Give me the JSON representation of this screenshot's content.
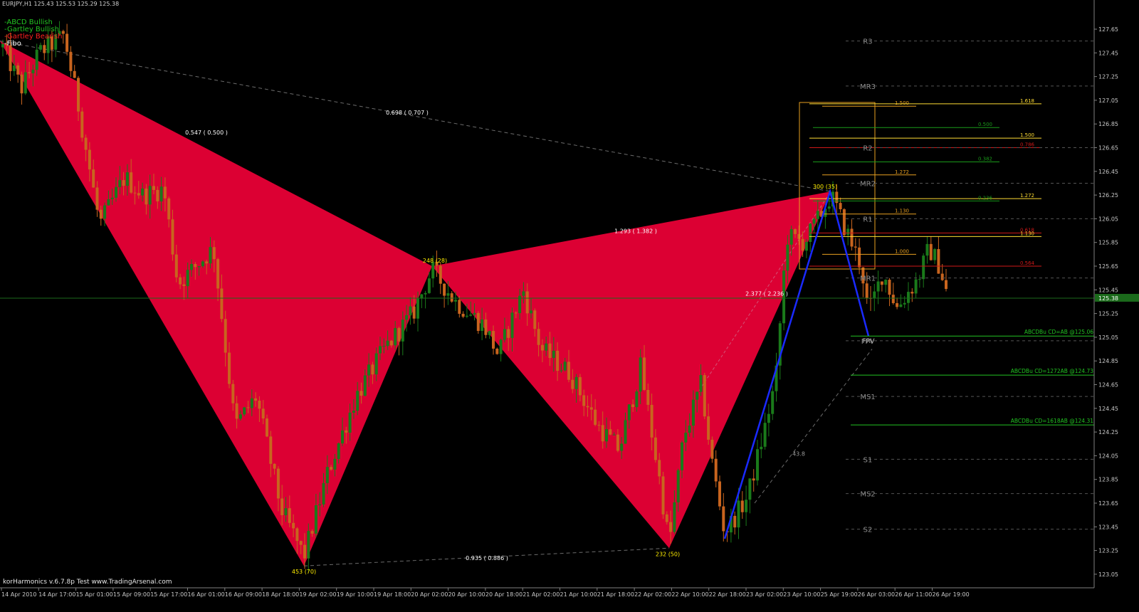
{
  "header": {
    "symbol_text": "EURJPY,H1  125.43 125.53 125.29 125.38"
  },
  "legend": {
    "items": [
      {
        "label": "-ABCD Bullish",
        "color": "#22c322"
      },
      {
        "label": "-Gartley Bullish",
        "color": "#22c322"
      },
      {
        "label": "-Gartley Bearish",
        "color": "#ff2020"
      },
      {
        "label": "-Fibo",
        "color": "#ffffff"
      }
    ]
  },
  "credit": "korHarmonics v.6.7.8p Test www.TradingArsenal.com",
  "colors": {
    "pattern_fill": "#dc0033",
    "bull_candle": "#1a7a1a",
    "bear_candle": "#c8641e",
    "fib_orange": "#e8a020",
    "fib_yellow": "#ffdd33",
    "fib_green": "#1a9a1a",
    "fib_red": "#d01818",
    "abcd_leg": "#1a2aff",
    "abcd_target": "#22c322",
    "pivot_text": "#8c8c8c"
  },
  "chart_data": {
    "type": "candlestick",
    "symbol": "EURJPY",
    "timeframe": "H1",
    "ylim": [
      122.95,
      127.8
    ],
    "current_price": "125.38",
    "y_ticks": [
      "127.65",
      "127.45",
      "127.25",
      "127.05",
      "126.85",
      "126.65",
      "126.45",
      "126.25",
      "126.05",
      "125.85",
      "125.65",
      "125.45",
      "125.25",
      "125.05",
      "124.85",
      "124.65",
      "124.45",
      "124.25",
      "124.05",
      "123.85",
      "123.65",
      "123.45",
      "123.25",
      "123.05"
    ],
    "x_ticks": [
      "14 Apr 2010",
      "14 Apr 17:00",
      "15 Apr 01:00",
      "15 Apr 09:00",
      "15 Apr 17:00",
      "16 Apr 01:00",
      "16 Apr 09:00",
      "18 Apr 18:00",
      "19 Apr 02:00",
      "19 Apr 10:00",
      "19 Apr 18:00",
      "20 Apr 02:00",
      "20 Apr 10:00",
      "20 Apr 18:00",
      "21 Apr 02:00",
      "21 Apr 10:00",
      "21 Apr 18:00",
      "22 Apr 02:00",
      "22 Apr 10:00",
      "22 Apr 18:00",
      "23 Apr 02:00",
      "23 Apr 10:00",
      "25 Apr 19:00",
      "26 Apr 03:00",
      "26 Apr 11:00",
      "26 Apr 19:00"
    ],
    "pattern": {
      "name": "Gartley Bearish",
      "points": [
        {
          "x": 0,
          "y": 127.55
        },
        {
          "x": 427,
          "y": 123.12
        },
        {
          "x": 607,
          "y": 125.65,
          "label": "248 (28)"
        },
        {
          "x": 940,
          "y": 123.27,
          "label": "232 (50)"
        },
        {
          "x": 1167,
          "y": 126.28,
          "label": "300 (35)"
        }
      ],
      "bottom_label": "453 (70)",
      "ratios": [
        {
          "text": "0.547 ( 0.500 )",
          "x": 290,
          "y": 126.76
        },
        {
          "text": "0.698 ( 0.707 )",
          "x": 572,
          "y": 126.93
        },
        {
          "text": "1.293 ( 1.382 )",
          "x": 893,
          "y": 125.93
        },
        {
          "text": "2.377 ( 2.236 )",
          "x": 1077,
          "y": 125.4
        },
        {
          "text": "0.935 ( 0.886 )",
          "x": 684,
          "y": 123.17
        },
        {
          "text": "43.8",
          "x": 1122,
          "y": 124.05
        }
      ]
    },
    "abcd": {
      "name": "ABCD Bullish",
      "points": [
        {
          "x": 1018,
          "y": 123.35
        },
        {
          "x": 1166,
          "y": 126.28
        },
        {
          "x": 1220,
          "y": 125.06,
          "label": "FRV"
        }
      ]
    },
    "pivots": [
      {
        "label": "R3",
        "price": 127.55
      },
      {
        "label": "MR3",
        "price": 127.17
      },
      {
        "label": "R2",
        "price": 126.65
      },
      {
        "label": "MR2",
        "price": 126.35
      },
      {
        "label": "R1",
        "price": 126.05
      },
      {
        "label": "MR1",
        "price": 125.55
      },
      {
        "label": "FPV",
        "price": 125.02
      },
      {
        "label": "MS1",
        "price": 124.55
      },
      {
        "label": "S1",
        "price": 124.02
      },
      {
        "label": "MS2",
        "price": 123.73
      },
      {
        "label": "S2",
        "price": 123.43
      }
    ],
    "fibo_levels": [
      {
        "text": "1.500",
        "price": 127.0,
        "color": "#e8a020",
        "x1": 1155,
        "x2": 1287,
        "label_x": 1277
      },
      {
        "text": "1.618",
        "price": 127.02,
        "color": "#ffdd33",
        "x1": 1137,
        "x2": 1463,
        "label_x": 1453
      },
      {
        "text": "0.500",
        "price": 126.82,
        "color": "#1a9a1a",
        "x1": 1142,
        "x2": 1404,
        "label_x": 1394
      },
      {
        "text": "1.500",
        "price": 126.73,
        "color": "#ffdd33",
        "x1": 1137,
        "x2": 1463,
        "label_x": 1453
      },
      {
        "text": "0.786",
        "price": 126.65,
        "color": "#d01818",
        "x1": 1137,
        "x2": 1463,
        "label_x": 1453
      },
      {
        "text": "0.382",
        "price": 126.53,
        "color": "#1a9a1a",
        "x1": 1142,
        "x2": 1404,
        "label_x": 1394
      },
      {
        "text": "1.272",
        "price": 126.42,
        "color": "#e8a020",
        "x1": 1155,
        "x2": 1287,
        "label_x": 1277
      },
      {
        "text": "1.272",
        "price": 126.22,
        "color": "#ffdd33",
        "x1": 1137,
        "x2": 1463,
        "label_x": 1453
      },
      {
        "text": "0.236",
        "price": 126.2,
        "color": "#1a9a1a",
        "x1": 1142,
        "x2": 1404,
        "label_x": 1394
      },
      {
        "text": "1.130",
        "price": 126.09,
        "color": "#e8a020",
        "x1": 1155,
        "x2": 1287,
        "label_x": 1277
      },
      {
        "text": "0.618",
        "price": 125.93,
        "color": "#d01818",
        "x1": 1137,
        "x2": 1463,
        "label_x": 1453
      },
      {
        "text": "1.130",
        "price": 125.9,
        "color": "#ffdd33",
        "x1": 1137,
        "x2": 1463,
        "label_x": 1453
      },
      {
        "text": "1.000",
        "price": 125.75,
        "color": "#e8a020",
        "x1": 1155,
        "x2": 1287,
        "label_x": 1277
      },
      {
        "text": "0.564",
        "price": 125.65,
        "color": "#d01818",
        "x1": 1137,
        "x2": 1463,
        "label_x": 1453
      }
    ],
    "abcd_targets": [
      {
        "text": "ABCDBu CD=AB   @125.06",
        "price": 125.06
      },
      {
        "text": "ABCDBu CD=1272AB   @124.73",
        "price": 124.73
      },
      {
        "text": "ABCDBu CD=1618AB   @124.31",
        "price": 124.31
      }
    ],
    "candles_note": "hourly candles sampled across the visible price path"
  }
}
